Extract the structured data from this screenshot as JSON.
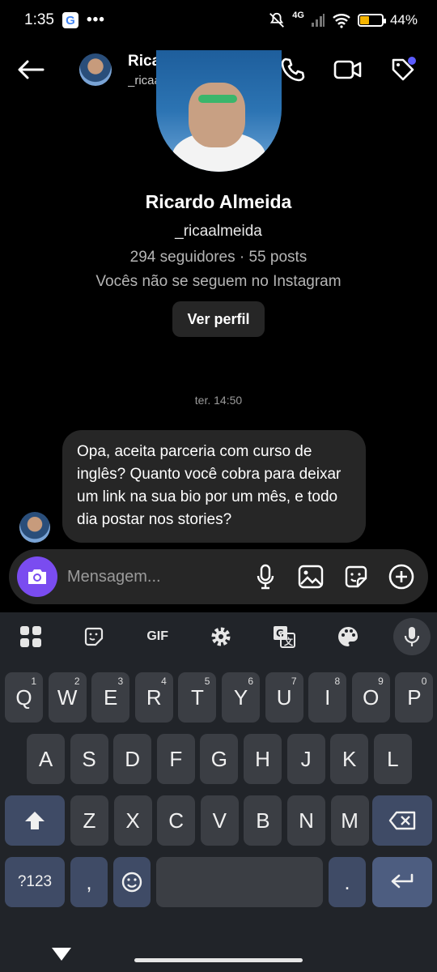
{
  "status": {
    "time": "1:35",
    "google_badge": "G",
    "more": "•••",
    "network": "4G",
    "battery_level": 0.44,
    "battery_text": "44%"
  },
  "header": {
    "name": "Ricardo ...",
    "username": "_ricaalmei..."
  },
  "profile": {
    "name": "Ricardo Almeida",
    "username": "_ricaalmeida",
    "stats": "294 seguidores · 55 posts",
    "follow_status": "Vocês não se seguem no Instagram",
    "view_profile_label": "Ver perfil"
  },
  "chat": {
    "timestamp": "ter. 14:50",
    "messages": [
      {
        "text": "Opa, aceita parceria com curso de inglês? Quanto você cobra para deixar um link na sua bio por um mês, e todo dia postar nos stories?"
      }
    ]
  },
  "composer": {
    "placeholder": "Mensagem..."
  },
  "keyboard": {
    "toolbar_gif": "GIF",
    "row1": [
      {
        "k": "Q",
        "n": "1"
      },
      {
        "k": "W",
        "n": "2"
      },
      {
        "k": "E",
        "n": "3"
      },
      {
        "k": "R",
        "n": "4"
      },
      {
        "k": "T",
        "n": "5"
      },
      {
        "k": "Y",
        "n": "6"
      },
      {
        "k": "U",
        "n": "7"
      },
      {
        "k": "I",
        "n": "8"
      },
      {
        "k": "O",
        "n": "9"
      },
      {
        "k": "P",
        "n": "0"
      }
    ],
    "row2": [
      "A",
      "S",
      "D",
      "F",
      "G",
      "H",
      "J",
      "K",
      "L"
    ],
    "row3": [
      "Z",
      "X",
      "C",
      "V",
      "B",
      "N",
      "M"
    ],
    "symbols_label": "?123",
    "comma": ",",
    "period": "."
  },
  "colors": {
    "accent": "#7a4cf0",
    "bubble": "#262626",
    "keyboard_bg": "#212429",
    "key": "#3b3e44"
  }
}
